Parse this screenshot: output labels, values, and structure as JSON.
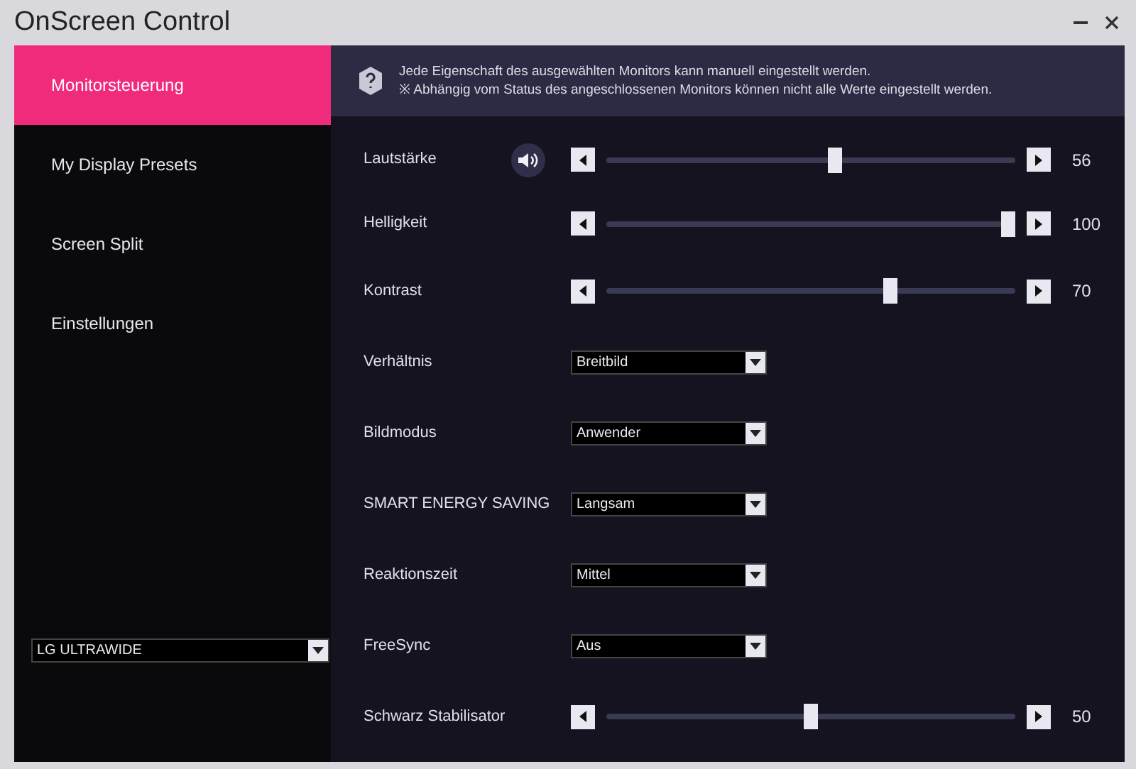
{
  "window": {
    "title": "OnScreen Control"
  },
  "sidebar": {
    "items": [
      {
        "label": "Monitorsteuerung",
        "selected": true
      },
      {
        "label": "My Display Presets",
        "selected": false
      },
      {
        "label": "Screen Split",
        "selected": false
      },
      {
        "label": "Einstellungen",
        "selected": false
      }
    ],
    "monitor_select": {
      "value": "LG ULTRAWIDE"
    }
  },
  "info": {
    "lines": [
      "Jede Eigenschaft des ausgewählten Monitors kann manuell eingestellt werden.",
      "※ Abhängig vom Status des angeschlossenen Monitors können nicht alle Werte eingestellt werden."
    ]
  },
  "settings": [
    {
      "kind": "slider",
      "label": "Lautstärke",
      "sound_icon": true,
      "level": 0.56,
      "reading": "56"
    },
    {
      "kind": "slider",
      "label": "Helligkeit",
      "sound_icon": false,
      "level": 1.0,
      "reading": "100"
    },
    {
      "kind": "slider",
      "label": "Kontrast",
      "sound_icon": false,
      "level": 0.7,
      "reading": "70"
    },
    {
      "kind": "dropdown",
      "label": "Verhältnis",
      "value": "Breitbild"
    },
    {
      "kind": "dropdown",
      "label": "Bildmodus",
      "value": "Anwender"
    },
    {
      "kind": "dropdown",
      "label": "SMART ENERGY SAVING",
      "value": "Langsam"
    },
    {
      "kind": "dropdown",
      "label": "Reaktionszeit",
      "value": "Mittel"
    },
    {
      "kind": "dropdown",
      "label": "FreeSync",
      "value": "Aus"
    },
    {
      "kind": "slider",
      "label": "Schwarz Stabilisator",
      "sound_icon": false,
      "level": 0.5,
      "reading": "50"
    }
  ]
}
